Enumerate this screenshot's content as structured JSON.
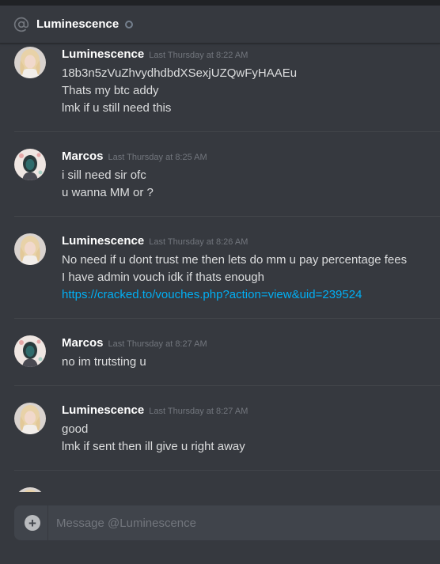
{
  "header": {
    "icon": "at-icon",
    "title": "Luminescence",
    "status": "offline"
  },
  "messages": [
    {
      "author": "Luminescence",
      "timestamp": "Last Thursday at 8:22 AM",
      "avatar": "blonde-avatar",
      "lines": [
        "18b3n5zVuZhvydhdbdXSexjUZQwFyHAAEu",
        "Thats my btc addy",
        "lmk if u still need this"
      ]
    },
    {
      "author": "Marcos",
      "timestamp": "Last Thursday at 8:25 AM",
      "avatar": "dark-hair-avatar",
      "lines": [
        "i sill need sir ofc",
        "u wanna MM or ?"
      ]
    },
    {
      "author": "Luminescence",
      "timestamp": "Last Thursday at 8:26 AM",
      "avatar": "blonde-avatar",
      "lines": [
        "No need if u dont trust me then lets do mm u pay percentage fees",
        "I have admin vouch idk if thats enough"
      ],
      "link": "https://cracked.to/vouches.php?action=view&uid=239524"
    },
    {
      "author": "Marcos",
      "timestamp": "Last Thursday at 8:27 AM",
      "avatar": "dark-hair-avatar",
      "lines": [
        "no im trutsting u"
      ]
    },
    {
      "author": "Luminescence",
      "timestamp": "Last Thursday at 8:27 AM",
      "avatar": "blonde-avatar",
      "lines": [
        "good",
        "lmk if sent then ill give u right away"
      ]
    }
  ],
  "composer": {
    "placeholder": "Message @Luminescence",
    "attach_icon": "plus-circle-icon"
  },
  "colors": {
    "background": "#36393f",
    "link": "#00aff4",
    "timestamp": "#72767d",
    "input": "#40444b"
  }
}
